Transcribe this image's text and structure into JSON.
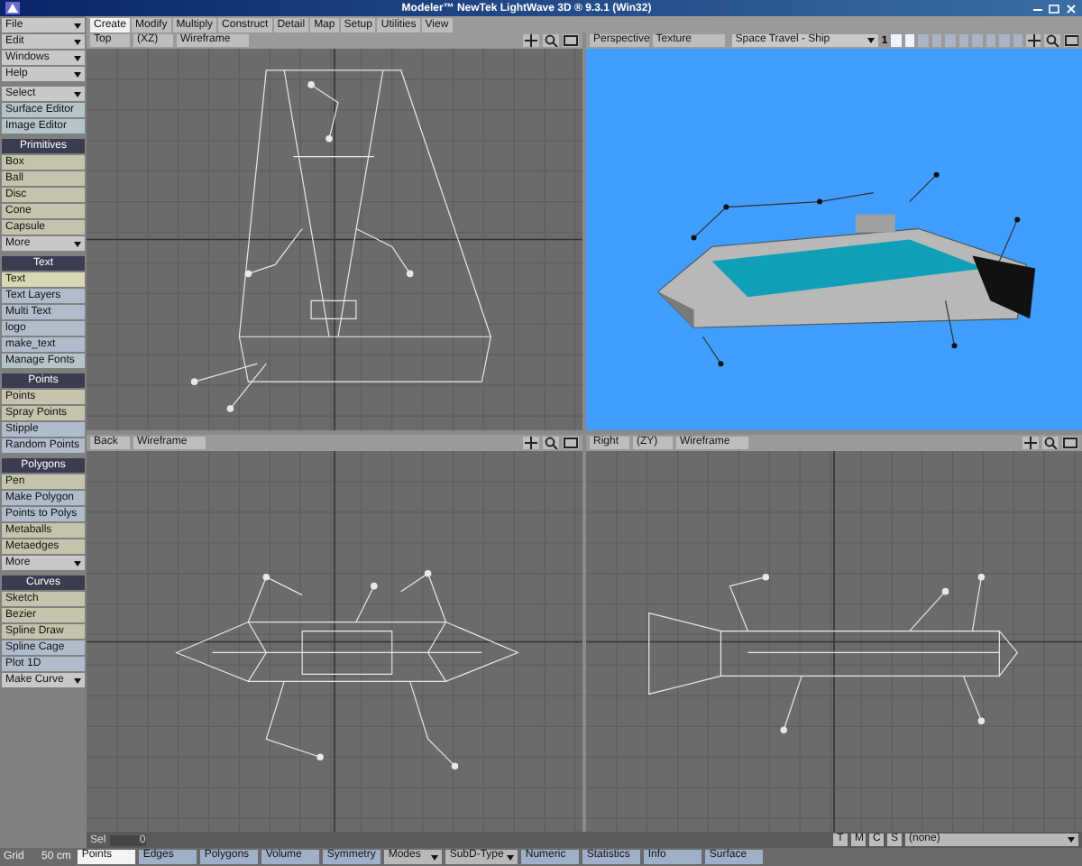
{
  "window": {
    "title": "Modeler™ NewTek LightWave 3D ® 9.3.1 (Win32)"
  },
  "tabs": [
    {
      "label": "Create",
      "selected": true
    },
    {
      "label": "Modify",
      "selected": false
    },
    {
      "label": "Multiply",
      "selected": false
    },
    {
      "label": "Construct",
      "selected": false
    },
    {
      "label": "Detail",
      "selected": false
    },
    {
      "label": "Map",
      "selected": false
    },
    {
      "label": "Setup",
      "selected": false
    },
    {
      "label": "Utilities",
      "selected": false
    },
    {
      "label": "View",
      "selected": false
    }
  ],
  "object": {
    "name": "Space Travel - Ship",
    "layer": "1"
  },
  "layers": [
    {
      "selected": true
    },
    {
      "selected": true
    },
    {
      "selected": false
    },
    {
      "selected": false
    },
    {
      "selected": false
    },
    {
      "selected": false
    },
    {
      "selected": false
    },
    {
      "selected": false
    },
    {
      "selected": false
    },
    {
      "selected": false
    }
  ],
  "sidebar": [
    {
      "items": [
        {
          "label": "File",
          "kind": "dropdown",
          "color": "#c8c8c8"
        },
        {
          "label": "Edit",
          "kind": "dropdown",
          "color": "#c8c8c8"
        },
        {
          "label": "Windows",
          "kind": "dropdown",
          "color": "#c8c8c8"
        },
        {
          "label": "Help",
          "kind": "dropdown",
          "color": "#c8c8c8"
        }
      ]
    },
    {
      "items": [
        {
          "label": "Select",
          "kind": "dropdown",
          "color": "#c8c8c8"
        },
        {
          "label": "Surface Editor",
          "kind": "button",
          "color": "#b4c4c8"
        },
        {
          "label": "Image Editor",
          "kind": "button",
          "color": "#b4c4c8"
        }
      ]
    },
    {
      "heading": "Primitives",
      "items": [
        {
          "label": "Box",
          "kind": "button",
          "color": "#c4c4ac"
        },
        {
          "label": "Ball",
          "kind": "button",
          "color": "#c4c4ac"
        },
        {
          "label": "Disc",
          "kind": "button",
          "color": "#c4c4ac"
        },
        {
          "label": "Cone",
          "kind": "button",
          "color": "#c4c4ac"
        },
        {
          "label": "Capsule",
          "kind": "button",
          "color": "#c4c4ac"
        },
        {
          "label": "More",
          "kind": "dropdown",
          "color": "#c8c8c8"
        }
      ]
    },
    {
      "heading": "Text",
      "items": [
        {
          "label": "Text",
          "kind": "button",
          "color": "#d8d8b4"
        },
        {
          "label": "Text Layers",
          "kind": "button",
          "color": "#b0bccc"
        },
        {
          "label": "Multi Text",
          "kind": "button",
          "color": "#b0bccc"
        },
        {
          "label": "logo",
          "kind": "button",
          "color": "#b0bccc"
        },
        {
          "label": "make_text",
          "kind": "button",
          "color": "#b0bccc"
        },
        {
          "label": "Manage Fonts",
          "kind": "button",
          "color": "#b4c4c8"
        }
      ]
    },
    {
      "heading": "Points",
      "items": [
        {
          "label": "Points",
          "kind": "button",
          "color": "#c4c4ac"
        },
        {
          "label": "Spray Points",
          "kind": "button",
          "color": "#c4c4ac"
        },
        {
          "label": "Stipple",
          "kind": "button",
          "color": "#b0bccc"
        },
        {
          "label": "Random Points",
          "kind": "button",
          "color": "#b0bccc"
        }
      ]
    },
    {
      "heading": "Polygons",
      "items": [
        {
          "label": "Pen",
          "kind": "button",
          "color": "#c4c4ac"
        },
        {
          "label": "Make Polygon",
          "kind": "button",
          "color": "#b0bccc"
        },
        {
          "label": "Points to Polys",
          "kind": "button",
          "color": "#b0bccc"
        },
        {
          "label": "Metaballs",
          "kind": "button",
          "color": "#c4c4ac"
        },
        {
          "label": "Metaedges",
          "kind": "button",
          "color": "#c4c4ac"
        },
        {
          "label": "More",
          "kind": "dropdown",
          "color": "#c8c8c8"
        }
      ]
    },
    {
      "heading": "Curves",
      "items": [
        {
          "label": "Sketch",
          "kind": "button",
          "color": "#c4c4ac"
        },
        {
          "label": "Bezier",
          "kind": "button",
          "color": "#c4c4ac"
        },
        {
          "label": "Spline Draw",
          "kind": "button",
          "color": "#c4c4ac"
        },
        {
          "label": "Spline Cage",
          "kind": "button",
          "color": "#b0bccc"
        },
        {
          "label": "Plot 1D",
          "kind": "button",
          "color": "#b0bccc"
        },
        {
          "label": "Make Curve",
          "kind": "dropdown",
          "color": "#c8c8c8"
        }
      ]
    }
  ],
  "viewports": [
    {
      "view": "Top",
      "axes": "(XZ)",
      "mode": "Wireframe",
      "kind": "top"
    },
    {
      "view": "Perspective",
      "mode": "Texture",
      "kind": "perspective"
    },
    {
      "view": "Back",
      "mode": "Wireframe",
      "kind": "back"
    },
    {
      "view": "Right",
      "axes": "(ZY)",
      "mode": "Wireframe",
      "kind": "right"
    }
  ],
  "selection": {
    "label": "Sel",
    "value": "0"
  },
  "grid": {
    "label": "Grid",
    "value": "50 cm"
  },
  "modes": [
    {
      "label": "Points",
      "selected": true
    },
    {
      "label": "Edges",
      "selected": false
    },
    {
      "label": "Polygons",
      "selected": false
    }
  ],
  "toggles": [
    {
      "label": "Volume",
      "kind": "button"
    },
    {
      "label": "Symmetry",
      "kind": "button"
    },
    {
      "label": "Modes",
      "kind": "dropdown"
    },
    {
      "label": "SubD-Type",
      "kind": "dropdown"
    },
    {
      "label": "Numeric",
      "kind": "button"
    },
    {
      "label": "Statistics",
      "kind": "button"
    },
    {
      "label": "Info",
      "kind": "button"
    },
    {
      "label": "Surface",
      "kind": "button"
    }
  ],
  "map_buttons": [
    "T",
    "M",
    "C",
    "S"
  ],
  "surface_select": "(none)"
}
